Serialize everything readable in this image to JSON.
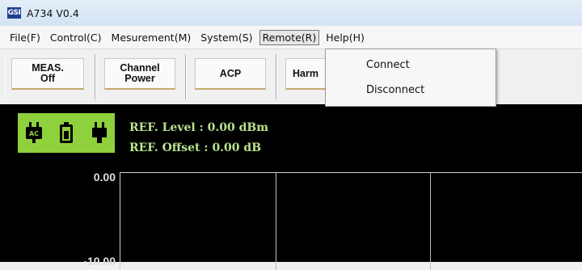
{
  "window": {
    "title": "A734 V0.4",
    "app_icon_text": "GSI"
  },
  "menubar": {
    "items": [
      "File(F)",
      "Control(C)",
      "Mesurement(M)",
      "System(S)",
      "Remote(R)",
      "Help(H)"
    ],
    "active": "Remote(R)"
  },
  "toolbar": {
    "buttons": [
      "MEAS.\nOff",
      "Channel\nPower",
      "ACP",
      "Harm"
    ]
  },
  "remote_menu": {
    "items": [
      "Connect",
      "Disconnect"
    ]
  },
  "display": {
    "ref_level": "REF. Level :  0.00 dBm",
    "ref_offset": "REF. Offset :  0.00 dB",
    "y_labels": [
      "0.00",
      "-10.00"
    ],
    "status_icons": [
      "ac-power-icon",
      "battery-icon",
      "plug-icon"
    ],
    "colors": {
      "status_box": "#8fd13c",
      "ref_text": "#b9e38e",
      "background": "#000000"
    }
  }
}
